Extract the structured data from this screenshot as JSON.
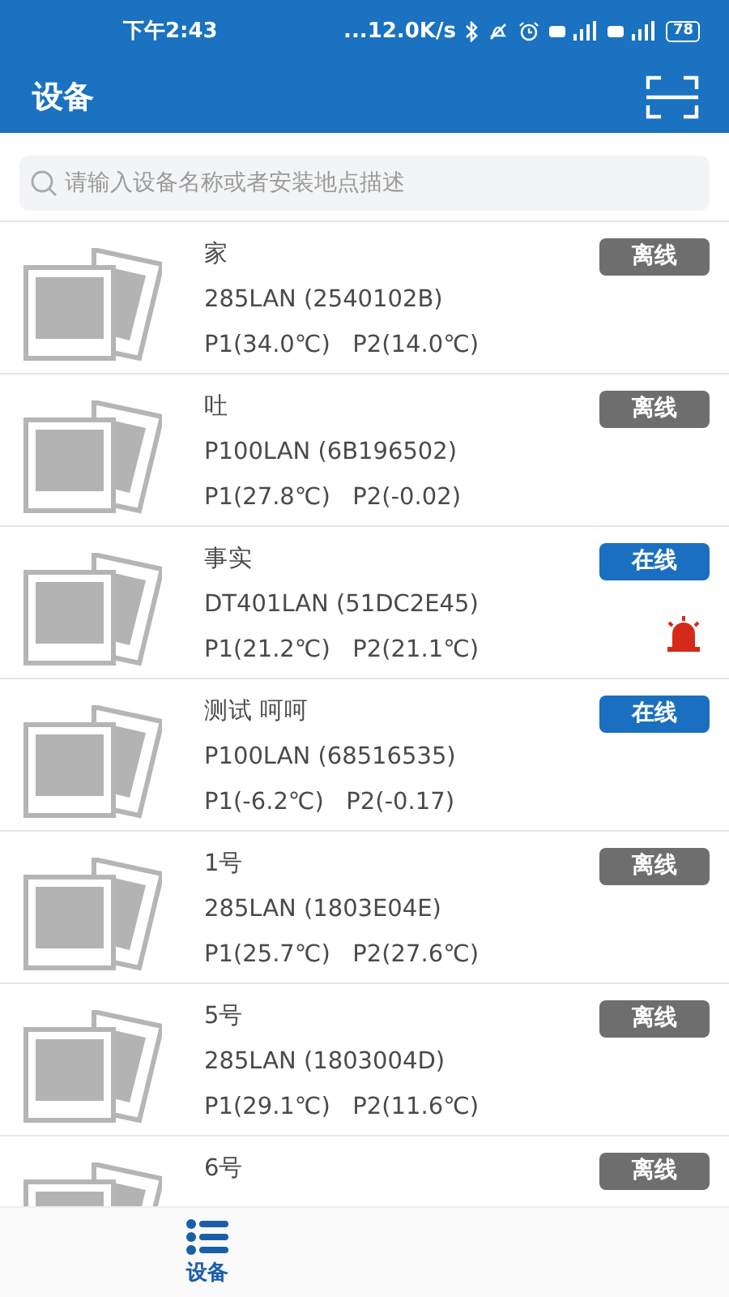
{
  "status_bar": {
    "time": "下午2:43",
    "network_speed": "...12.0K/s",
    "battery": "78"
  },
  "header": {
    "title": "设备"
  },
  "search": {
    "placeholder": "请输入设备名称或者安装地点描述"
  },
  "devices": [
    {
      "name": "家",
      "model": "285LAN (2540102B)",
      "readings": "P1(34.0℃)   P2(14.0℃)",
      "status": "离线",
      "online": false,
      "alarm": false
    },
    {
      "name": "吐",
      "model": "P100LAN (6B196502)",
      "readings": "P1(27.8℃)   P2(-0.02)",
      "status": "离线",
      "online": false,
      "alarm": false
    },
    {
      "name": "事实",
      "model": "DT401LAN (51DC2E45)",
      "readings": "P1(21.2℃)   P2(21.1℃)",
      "status": "在线",
      "online": true,
      "alarm": true
    },
    {
      "name": "测试 呵呵",
      "model": "P100LAN (68516535)",
      "readings": "P1(-6.2℃)   P2(-0.17)",
      "status": "在线",
      "online": true,
      "alarm": false
    },
    {
      "name": "1号",
      "model": "285LAN (1803E04E)",
      "readings": "P1(25.7℃)   P2(27.6℃)",
      "status": "离线",
      "online": false,
      "alarm": false
    },
    {
      "name": "5号",
      "model": "285LAN (1803004D)",
      "readings": "P1(29.1℃)   P2(11.6℃)",
      "status": "离线",
      "online": false,
      "alarm": false
    },
    {
      "name": "6号",
      "status": "离线",
      "online": false,
      "alarm": false
    }
  ],
  "bottom_nav": [
    {
      "label": "设备",
      "selected": true
    }
  ]
}
